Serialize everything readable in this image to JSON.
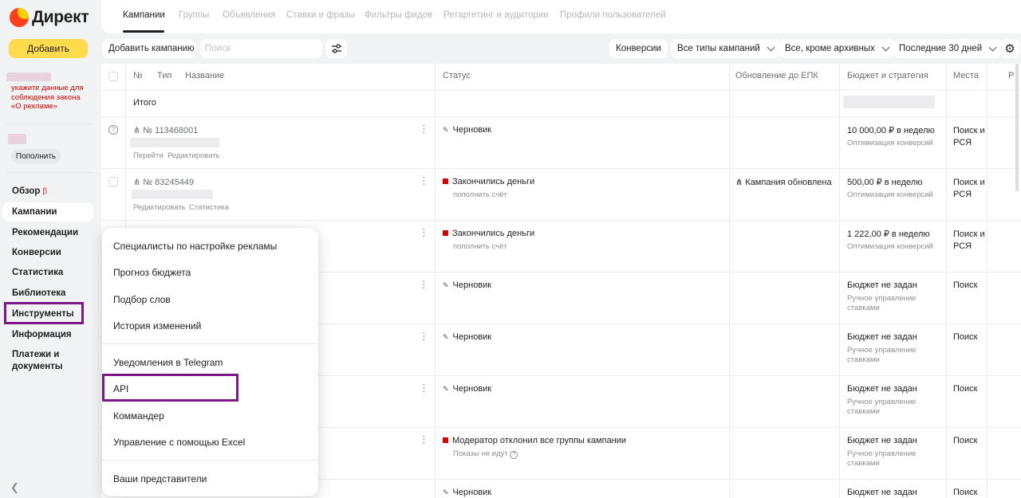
{
  "sidebar": {
    "logo": "Директ",
    "add_button": "Добавить",
    "law_notice": "укажите данные для соблюдения закона «О рекламе»",
    "topup_button": "Пополнить",
    "nav": [
      {
        "label": "Обзор",
        "badge": "β"
      },
      {
        "label": "Кампании"
      },
      {
        "label": "Рекомендации"
      },
      {
        "label": "Конверсии"
      },
      {
        "label": "Статистика"
      },
      {
        "label": "Библиотека"
      },
      {
        "label": "Инструменты"
      },
      {
        "label": "Информация"
      },
      {
        "label": "Платежи и документы"
      }
    ]
  },
  "tabs": [
    "Кампании",
    "Группы",
    "Объявления",
    "Ставки и фразы",
    "Фильтры фидов",
    "Ретаргетинг и аудитории",
    "Профили пользователей"
  ],
  "toolbar": {
    "add_campaign": "Добавить кампанию",
    "search_placeholder": "Поиск",
    "conversions": "Конверсии",
    "campaign_types": "Все типы кампаний",
    "archive_filter": "Все, кроме архивных",
    "period": "Последние 30 дней"
  },
  "table": {
    "headers": {
      "num": "№",
      "type": "Тип",
      "name": "Название",
      "status": "Статус",
      "epk": "Обновление до ЕПК",
      "budget": "Бюджет и стратегия",
      "places": "Места",
      "extra": "Р"
    },
    "total": "Итого",
    "rows": [
      {
        "id": "№ 113468001",
        "links": [
          "Перейти",
          "Редактировать"
        ],
        "status": "Черновик",
        "status_type": "draft",
        "status_sub": "",
        "epk": "",
        "budget": "10 000,00 ₽ в неделю",
        "strategy": "Оптимизация конверсий",
        "places": "Поиск и РСЯ"
      },
      {
        "id": "№ 83245449",
        "links": [
          "Редактировать",
          "Статистика"
        ],
        "status": "Закончились деньги",
        "status_type": "stopped",
        "status_sub": "пополнить счёт",
        "epk": "Кампания обновлена",
        "budget": "500,00 ₽ в неделю",
        "strategy": "Оптимизация конверсий",
        "places": "Поиск и РСЯ"
      },
      {
        "status": "Закончились деньги",
        "status_type": "stopped",
        "status_sub": "пополнить счёт",
        "budget": "1 222,00 ₽ в неделю",
        "strategy": "Оптимизация конверсий",
        "places": "Поиск и РСЯ"
      },
      {
        "status": "Черновик",
        "status_type": "draft",
        "budget": "Бюджет не задан",
        "strategy": "Ручное управление ставками",
        "places": "Поиск"
      },
      {
        "status": "Черновик",
        "status_type": "draft",
        "budget": "Бюджет не задан",
        "strategy": "Ручное управление ставками",
        "places": "Поиск"
      },
      {
        "status": "Черновик",
        "status_type": "draft",
        "budget": "Бюджет не задан",
        "strategy": "Ручное управление ставками",
        "places": "Поиск"
      },
      {
        "status": "Модератор отклонил все группы кампании",
        "status_type": "stopped",
        "status_sub": "Показы не идут",
        "budget": "Бюджет не задан",
        "strategy": "Ручное управление ставками",
        "places": "Поиск"
      },
      {
        "status": "Черновик",
        "status_type": "draft",
        "budget": "Бюджет не задан",
        "places": "Поиск"
      }
    ]
  },
  "tools_menu": {
    "items": [
      "Специалисты по настройке рекламы",
      "Прогноз бюджета",
      "Подбор слов",
      "История изменений",
      "Уведомления в Telegram",
      "API",
      "Коммандер",
      "Управление с помощью Excel",
      "Ваши представители"
    ]
  },
  "colors": {
    "accent_yellow": "#ffdb4d",
    "highlight_purple": "#7b1a86",
    "status_red": "#d60000"
  }
}
